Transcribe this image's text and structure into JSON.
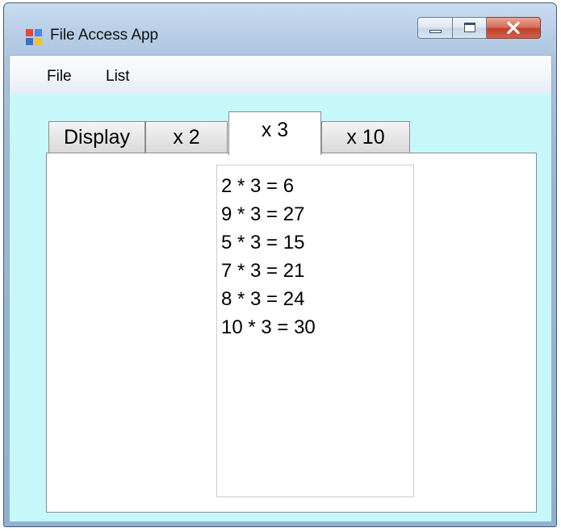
{
  "window": {
    "title": "File Access App",
    "icon": "winforms-app-icon"
  },
  "caption_buttons": {
    "minimize_icon": "minimize-icon",
    "maximize_icon": "maximize-icon",
    "close_icon": "close-icon"
  },
  "menu": {
    "items": [
      {
        "label": "File"
      },
      {
        "label": "List"
      }
    ]
  },
  "tabs": [
    {
      "label": "Display",
      "selected": false
    },
    {
      "label": "x 2",
      "selected": false
    },
    {
      "label": "x 3",
      "selected": true
    },
    {
      "label": "x 10",
      "selected": false
    }
  ],
  "list": {
    "items": [
      "2 * 3 = 6",
      "9 * 3 = 27",
      "5 * 3 = 15",
      "7 * 3 = 21",
      "8 * 3 = 24",
      "10 * 3 = 30"
    ]
  },
  "colors": {
    "client_background": "#c6f7fb",
    "close_button": "#c1402a",
    "tab_panel": "#ffffff"
  }
}
